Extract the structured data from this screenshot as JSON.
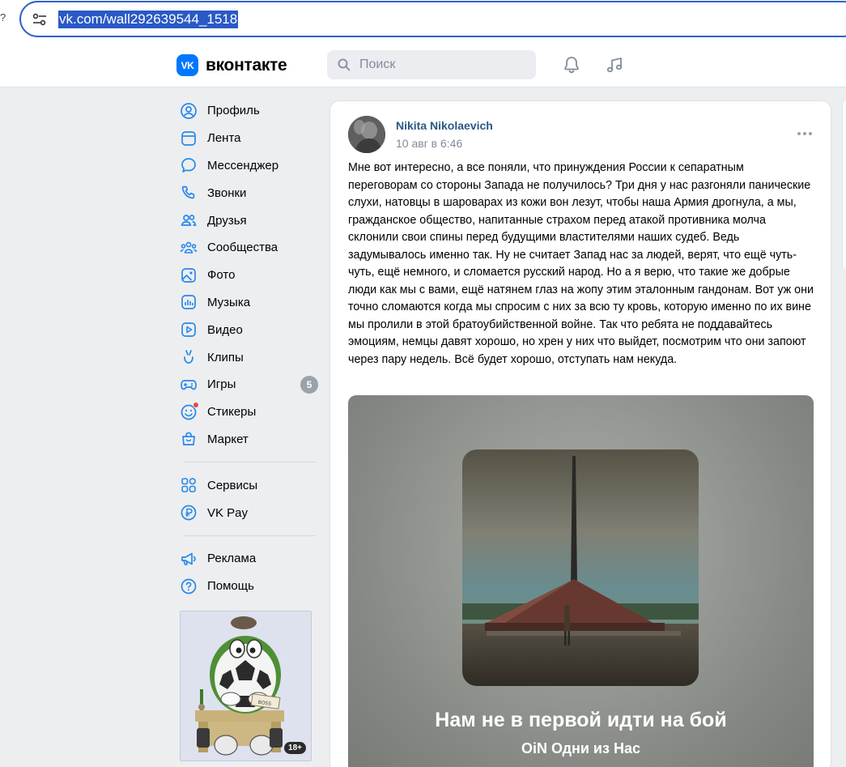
{
  "browser": {
    "url": "vk.com/wall292639544_1518",
    "edge_glyph": "?"
  },
  "header": {
    "logo_mark": "VK",
    "logo_text": "вконтакте",
    "search_placeholder": "Поиск",
    "icons": [
      "bell-icon",
      "music-note-icon"
    ]
  },
  "nav": {
    "items": [
      {
        "label": "Профиль",
        "icon": "profile-icon"
      },
      {
        "label": "Лента",
        "icon": "feed-icon"
      },
      {
        "label": "Мессенджер",
        "icon": "messenger-icon"
      },
      {
        "label": "Звонки",
        "icon": "phone-icon"
      },
      {
        "label": "Друзья",
        "icon": "friends-icon"
      },
      {
        "label": "Сообщества",
        "icon": "communities-icon"
      },
      {
        "label": "Фото",
        "icon": "photo-icon"
      },
      {
        "label": "Музыка",
        "icon": "music-icon"
      },
      {
        "label": "Видео",
        "icon": "video-icon"
      },
      {
        "label": "Клипы",
        "icon": "clips-icon"
      },
      {
        "label": "Игры",
        "icon": "games-icon",
        "badge": "5"
      },
      {
        "label": "Стикеры",
        "icon": "stickers-icon"
      },
      {
        "label": "Маркет",
        "icon": "market-icon"
      }
    ],
    "services": [
      {
        "label": "Сервисы",
        "icon": "services-icon"
      },
      {
        "label": "VK Pay",
        "icon": "vkpay-icon"
      }
    ],
    "extra": [
      {
        "label": "Реклама",
        "icon": "ads-icon"
      },
      {
        "label": "Помощь",
        "icon": "help-icon"
      }
    ],
    "promo": {
      "age_label": "18+",
      "sign_text": "BOSS"
    }
  },
  "post": {
    "author": "Nikita Nikolaevich",
    "date": "10 авг в 6:46",
    "text": "Мне вот интересно, а все поняли, что принуждения России к сепаратным переговорам со стороны Запада не получилось? Три дня у нас разгоняли панические слухи, натовцы в шароварах из кожи вон лезут, чтобы наша Армия дрогнула, а мы, гражданское общество, напитанные страхом перед атакой противника молча склонили свои спины перед будущими властителями наших судеб. Ведь задумывалось именно так. Ну не считает Запад нас за людей, верят, что ещё чуть-чуть, ещё немного, и сломается русский народ. Но а я верю, что такие же добрые люди как мы с вами, ещё натянем глаз на жопу этим эталонным гандонам. Вот уж они точно сломаются когда мы спросим с них за всю ту кровь, которую именно по их вине мы пролили в этой братоубийственной войне. Так что ребята не поддавайтесь эмоциям, немцы давят хорошо, но хрен у них что выйдет, посмотрим что они запоют через пару недель. Всё будет хорошо, отступать нам некуда.",
    "media": {
      "track_title": "Нам не в первой идти на бой",
      "track_artist": "OiN Одни из Нас"
    }
  },
  "colors": {
    "accent": "#0077ff",
    "link": "#2a5885",
    "muted": "#818c99",
    "page_bg": "#edeef0"
  }
}
